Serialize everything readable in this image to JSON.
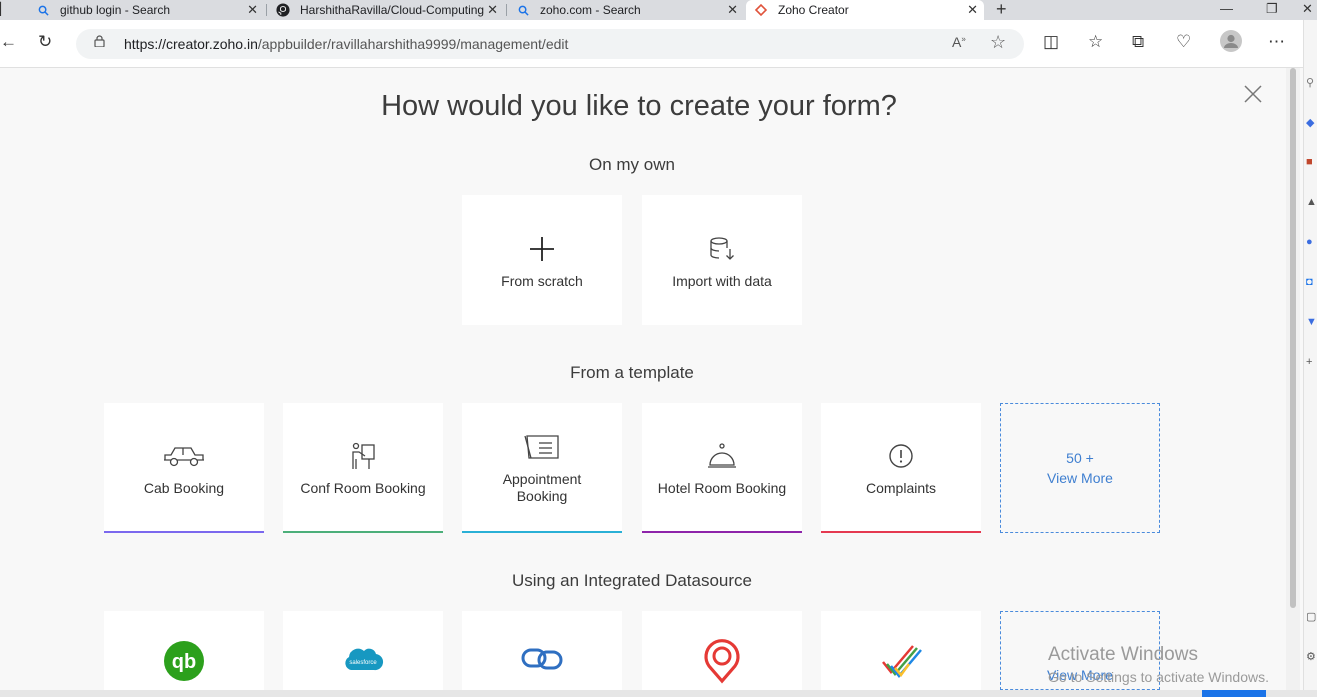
{
  "browser": {
    "tabs": [
      {
        "title": "github login - Search",
        "icon": "search-icon"
      },
      {
        "title": "HarshithaRavilla/Cloud-Computing",
        "icon": "github-icon"
      },
      {
        "title": "zoho.com - Search",
        "icon": "search-icon"
      },
      {
        "title": "Zoho Creator",
        "icon": "zoho-icon",
        "active": true
      }
    ],
    "url_host": "https://creator.zoho.in",
    "url_path": "/appbuilder/ravillaharshitha9999/management/edit"
  },
  "page": {
    "headline": "How would you like to create your form?",
    "sections": {
      "own": "On my own",
      "template": "From a template",
      "datasource": "Using an Integrated Datasource"
    },
    "own_options": [
      {
        "label": "From scratch",
        "icon": "plus-icon"
      },
      {
        "label": "Import with data",
        "icon": "database-import-icon"
      }
    ],
    "templates": [
      {
        "label": "Cab Booking",
        "icon": "car-icon",
        "accent": "#7b68ee"
      },
      {
        "label": "Conf Room Booking",
        "icon": "presentation-icon",
        "accent": "#4caf7a"
      },
      {
        "label": "Appointment Booking",
        "icon": "notebook-icon",
        "accent": "#2ab0d6"
      },
      {
        "label": "Hotel Room Booking",
        "icon": "service-bell-icon",
        "accent": "#8e24aa"
      },
      {
        "label": "Complaints",
        "icon": "exclamation-icon",
        "accent": "#e53950"
      }
    ],
    "templates_more": {
      "count": "50 +",
      "label": "View More"
    },
    "datasources": [
      {
        "icon": "quickbooks-icon",
        "color": "#2ca01c"
      },
      {
        "icon": "salesforce-icon",
        "color": "#1798c1"
      },
      {
        "icon": "zoho-crm-icon",
        "color": "#2f6fc1"
      },
      {
        "icon": "location-pin-icon",
        "color": "#e53935"
      },
      {
        "icon": "zoho-projects-icon",
        "color": "#e8a33d"
      }
    ],
    "datasources_more": {
      "label": "View More"
    }
  },
  "os": {
    "watermark_title": "Activate Windows",
    "watermark_sub": "Go to Settings to activate Windows."
  }
}
